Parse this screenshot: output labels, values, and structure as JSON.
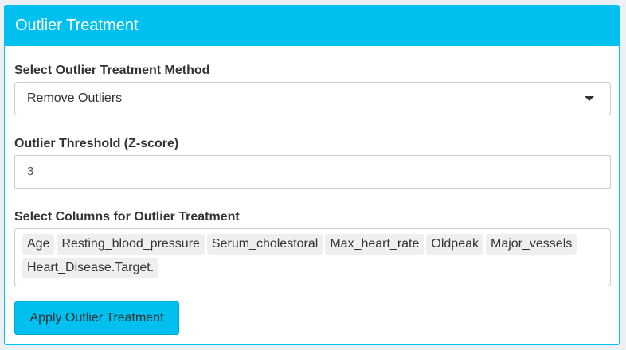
{
  "panel": {
    "title": "Outlier Treatment"
  },
  "method": {
    "label": "Select Outlier Treatment Method",
    "selected": "Remove Outliers"
  },
  "threshold": {
    "label": "Outlier Threshold (Z-score)",
    "value": "3"
  },
  "columns": {
    "label": "Select Columns for Outlier Treatment",
    "selected": [
      "Age",
      "Resting_blood_pressure",
      "Serum_cholestoral",
      "Max_heart_rate",
      "Oldpeak",
      "Major_vessels",
      "Heart_Disease.Target."
    ]
  },
  "apply_button": {
    "label": "Apply Outlier Treatment"
  },
  "colors": {
    "accent": "#00c0ef",
    "chip_bg": "#efefef"
  }
}
